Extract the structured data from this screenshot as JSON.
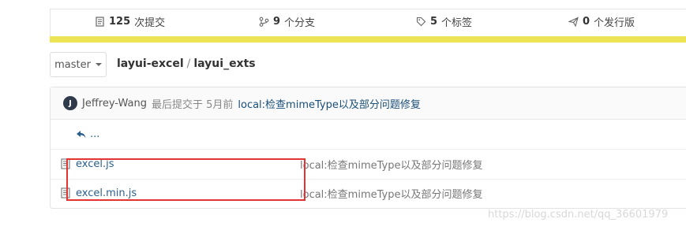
{
  "stats": {
    "commits": {
      "count": "125",
      "label": "次提交"
    },
    "branches": {
      "count": "9",
      "label": "个分支"
    },
    "tags": {
      "count": "5",
      "label": "个标签"
    },
    "releases": {
      "count": "0",
      "label": "个发行版"
    }
  },
  "branch": {
    "name": "master"
  },
  "breadcrumb": {
    "repo": "layui-excel",
    "separator": "/",
    "folder": "layui_exts"
  },
  "commit": {
    "avatar_letter": "J",
    "author": "Jeffrey-Wang",
    "meta": "最后提交于 5月前",
    "message": "local:检查mimeType以及部分问题修复"
  },
  "parent": {
    "label": "..."
  },
  "files": [
    {
      "name": "excel.js",
      "message": "local:检查mimeType以及部分问题修复"
    },
    {
      "name": "excel.min.js",
      "message": "local:检查mimeType以及部分问题修复"
    }
  ],
  "watermark": "https://blog.csdn.net/qq_36601979",
  "colors": {
    "accent_bar": "#ece355",
    "highlight": "#e53333",
    "link": "#2b5f8e"
  }
}
